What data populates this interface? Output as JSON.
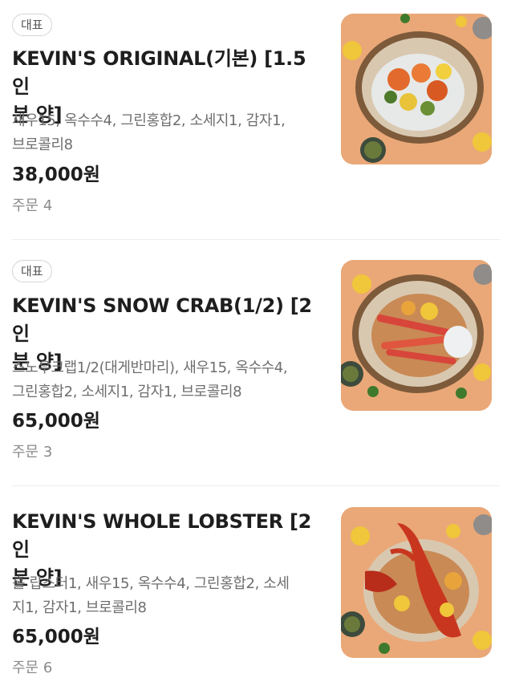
{
  "menu": {
    "items": [
      {
        "badge": "대표",
        "title": "KEVIN'S ORIGINAL(기본) [1.5인분 양]",
        "title_line1": "KEVIN'S ORIGINAL(기본) [1.5인",
        "title_line2": "분 양]",
        "desc_line1": "새우15, 옥수수4, 그린홍합2, 소세지1, 감자1,",
        "desc_line2": "브로콜리8",
        "price": "38,000원",
        "orders": "주문 4",
        "image_alt": "seafood boil in bag"
      },
      {
        "badge": "대표",
        "title": "KEVIN'S SNOW CRAB(1/2) [2인분 양]",
        "title_line1": "KEVIN'S SNOW CRAB(1/2) [2인",
        "title_line2": "분 양]",
        "desc_line1": "스노우크랩1/2(대게반마리), 새우15, 옥수수4,",
        "desc_line2": "그린홍합2, 소세지1, 감자1, 브로콜리8",
        "price": "65,000원",
        "orders": "주문 3",
        "image_alt": "snow crab seafood boil"
      },
      {
        "badge": "",
        "title": "KEVIN'S WHOLE LOBSTER [2인분 양]",
        "title_line1": "KEVIN'S WHOLE LOBSTER [2인",
        "title_line2": "분 양]",
        "desc_line1": "홀 랍스터1, 새우15, 옥수수4, 그린홍합2, 소세",
        "desc_line2": "지1, 감자1, 브로콜리8",
        "price": "65,000원",
        "orders": "주문 6",
        "image_alt": "whole lobster seafood boil"
      }
    ]
  },
  "colors": {
    "background": "#ffffff",
    "title": "#1e1e1e",
    "desc": "#6e6e6e",
    "orders": "#8a8a8a",
    "badge_border": "#d5d5d5",
    "divider": "#ececec",
    "food_bg": "#e9a978"
  }
}
